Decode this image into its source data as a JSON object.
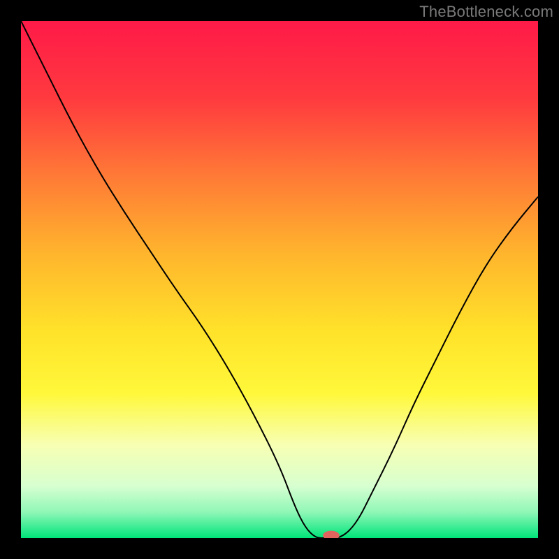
{
  "watermark": "TheBottleneck.com",
  "chart_data": {
    "type": "line",
    "title": "",
    "xlabel": "",
    "ylabel": "",
    "xlim": [
      0,
      100
    ],
    "ylim": [
      0,
      100
    ],
    "grid": false,
    "legend": false,
    "background": {
      "type": "vertical-gradient",
      "stops": [
        {
          "y": 0,
          "color": "#ff1a48"
        },
        {
          "y": 15,
          "color": "#ff3a3f"
        },
        {
          "y": 30,
          "color": "#ff7a36"
        },
        {
          "y": 45,
          "color": "#ffb52d"
        },
        {
          "y": 60,
          "color": "#ffe22a"
        },
        {
          "y": 72,
          "color": "#fff83a"
        },
        {
          "y": 82,
          "color": "#f7ffb3"
        },
        {
          "y": 90,
          "color": "#d7ffd0"
        },
        {
          "y": 95,
          "color": "#8ff7b7"
        },
        {
          "y": 100,
          "color": "#00e47a"
        }
      ]
    },
    "series": [
      {
        "name": "bottleneck-curve",
        "stroke": "#000000",
        "stroke_width": 2,
        "x": [
          0,
          5,
          10,
          15,
          20,
          25,
          30,
          35,
          40,
          45,
          50,
          53,
          55,
          57,
          59,
          62,
          65,
          68,
          72,
          76,
          80,
          85,
          90,
          95,
          100
        ],
        "y": [
          100,
          90,
          80,
          71,
          63,
          55.5,
          48,
          41,
          33,
          24,
          14,
          6,
          2,
          0,
          0,
          0,
          3,
          9,
          17,
          26,
          34,
          44,
          53,
          60,
          66
        ]
      }
    ],
    "marker": {
      "name": "current-match",
      "shape": "pill",
      "cx": 60.0,
      "cy": 0.5,
      "rx": 1.6,
      "ry": 0.9,
      "fill": "#e2645f"
    }
  }
}
